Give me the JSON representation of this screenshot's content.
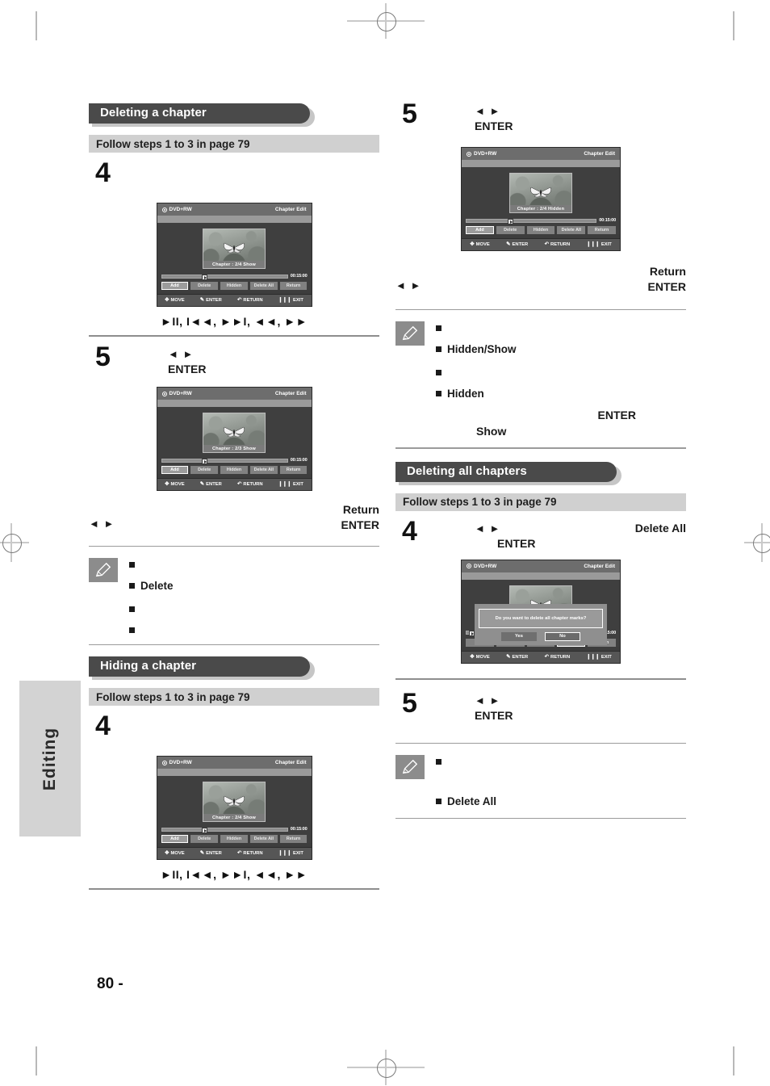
{
  "page": {
    "number": "80 -",
    "side_tab": "Editing"
  },
  "sections": {
    "deleting_chapter": {
      "title": "Deleting a chapter",
      "follow": "Follow steps 1 to 3 in page 79",
      "step4_num": "4",
      "step5_num": "5",
      "step5_arrows": "◄ ►",
      "step5_enter": "ENTER",
      "glyphs": "►II, I◄◄, ►►I, ◄◄, ►►",
      "key_return": "Return",
      "key_enter": "ENTER",
      "key_arrows": "◄ ►",
      "notes": [
        "",
        "Delete",
        "",
        ""
      ]
    },
    "hiding_chapter": {
      "title": "Hiding a chapter",
      "follow": "Follow steps 1 to 3 in page 79",
      "step4_num": "4",
      "glyphs": "►II, I◄◄, ►►I, ◄◄, ►►"
    },
    "hiding_chapter_cont": {
      "step5_num": "5",
      "step5_arrows": "◄ ►",
      "step5_enter": "ENTER",
      "key_return": "Return",
      "key_enter": "ENTER",
      "key_arrows": "◄ ►",
      "notes": [
        "",
        "Hidden/Show",
        "",
        "Hidden"
      ],
      "tail_enter": "ENTER",
      "tail_show": "Show"
    },
    "deleting_all": {
      "title": "Deleting all chapters",
      "follow": "Follow steps 1 to 3 in page 79",
      "step4_num": "4",
      "step4_arrows": "◄ ►",
      "step4_enter": "ENTER",
      "step4_tail": "Delete All",
      "step5_num": "5",
      "step5_arrows": "◄ ►",
      "step5_enter": "ENTER",
      "notes": [
        "",
        "Delete All"
      ]
    }
  },
  "osd": {
    "disc_label": "DVD+RW",
    "mode_label": "Chapter Edit",
    "time": "00:15:00",
    "buttons": [
      "Add",
      "Delete",
      "Hidden",
      "Delete All",
      "Return"
    ],
    "footer": [
      {
        "glyph": "✥",
        "label": "MOVE"
      },
      {
        "glyph": "✎",
        "label": "ENTER"
      },
      {
        "glyph": "↶",
        "label": "RETURN"
      },
      {
        "glyph": "❙❙❙",
        "label": "EXIT"
      }
    ],
    "caption_show_24": "Chapter : 2/4 Show",
    "caption_show_23": "Chapter : 2/3 Show",
    "caption_hidden_24": "Chapter : 2/4 Hidden",
    "dialog": {
      "message": "Do you want to delete all chapter marks?",
      "yes": "Yes",
      "no": "No"
    },
    "selected_button_index": 0,
    "selected_button_deleteall": "Delete All"
  },
  "colors": {
    "section_bar": "#4a4a4a",
    "band": "#d0d0d0",
    "osd_bg": "#3f3f3f",
    "osd_head": "#6d6d6d",
    "side_tab": "#d3d3d3"
  }
}
